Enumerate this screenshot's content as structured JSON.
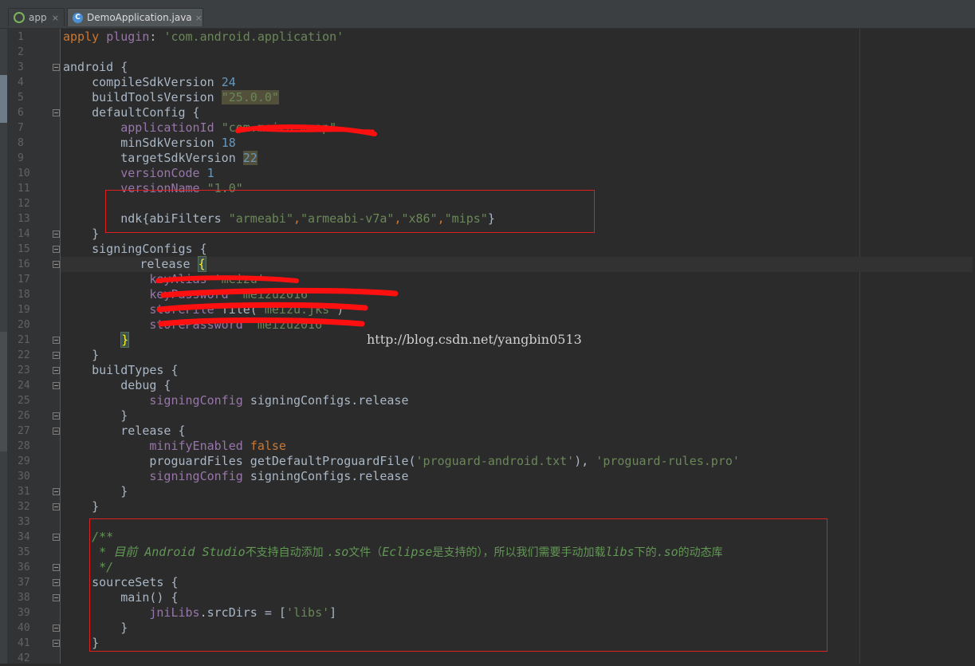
{
  "tabs": [
    {
      "label": "app",
      "close": "×",
      "icon": "gradle-icon"
    },
    {
      "label": "DemoApplication.java",
      "close": "×",
      "icon": "class-icon",
      "icon_letter": "C",
      "active": true
    }
  ],
  "watermark": "http://blog.csdn.net/yangbin0513",
  "gutter": {
    "line_numbers": [
      "1",
      "2",
      "3",
      "4",
      "5",
      "6",
      "7",
      "8",
      "9",
      "10",
      "11",
      "12",
      "13",
      "14",
      "15",
      "16",
      "17",
      "18",
      "19",
      "20",
      "21",
      "22",
      "23",
      "24",
      "25",
      "26",
      "27",
      "28",
      "29",
      "30",
      "31",
      "32",
      "33",
      "34",
      "35",
      "36",
      "37",
      "38",
      "39",
      "40",
      "41",
      "42"
    ]
  },
  "code": {
    "l1": {
      "kw": "apply ",
      "prop": "plugin",
      "rest": ": ",
      "str": "'com.android.application'"
    },
    "l3": {
      "text": "android {"
    },
    "l4": {
      "text": "    compileSdkVersion ",
      "num": "24"
    },
    "l5": {
      "text": "    buildToolsVersion ",
      "str": "\"25.0.0\""
    },
    "l6": {
      "text": "    defaultConfig {"
    },
    "l7": {
      "prop": "        applicationId ",
      "str": "\"com.meizu.mmap\""
    },
    "l8": {
      "text": "        minSdkVersion ",
      "num": "18"
    },
    "l9": {
      "text": "        targetSdkVersion ",
      "num": "22"
    },
    "l10": {
      "prop": "        versionCode ",
      "num": "1"
    },
    "l11": {
      "prop": "        versionName ",
      "str": "\"1.0\""
    },
    "l13": {
      "text": "        ndk{abiFilters ",
      "s1": "\"armeabi\"",
      "c1": ",",
      "s2": "\"armeabi-v7a\"",
      "c2": ",",
      "s3": "\"x86\"",
      "c3": ",",
      "s4": "\"mips\"",
      "end": "}"
    },
    "l14": {
      "text": "    }"
    },
    "l15": {
      "text": "    signingConfigs {"
    },
    "l16": {
      "text": "        release ",
      "brace": "{"
    },
    "l17": {
      "prop": "            keyAlias ",
      "str": "'meizu'"
    },
    "l18": {
      "prop": "            keyPassword ",
      "str": "'meizu2016'"
    },
    "l19": {
      "prop": "            storeFile ",
      "text": "file(",
      "str": "'meizu.jks'",
      "end": ")"
    },
    "l20": {
      "prop": "            storePassword ",
      "str": "'meizu2016'"
    },
    "l21": {
      "pre": "        ",
      "brace": "}"
    },
    "l22": {
      "text": "    }"
    },
    "l23": {
      "text": "    buildTypes {"
    },
    "l24": {
      "text": "        debug {"
    },
    "l25": {
      "prop": "            signingConfig ",
      "text": "signingConfigs.release"
    },
    "l26": {
      "text": "        }"
    },
    "l27": {
      "text": "        release {"
    },
    "l28": {
      "prop": "            minifyEnabled ",
      "kw": "false"
    },
    "l29": {
      "text": "            proguardFiles getDefaultProguardFile(",
      "s1": "'proguard-android.txt'",
      "mid": "), ",
      "s2": "'proguard-rules.pro'"
    },
    "l30": {
      "prop": "            signingConfig ",
      "text": "signingConfigs.release"
    },
    "l31": {
      "text": "        }"
    },
    "l32": {
      "text": "    }"
    },
    "l34": {
      "text": "    /**"
    },
    "l35": {
      "a": "     * 目前 ",
      "b": "Android Studio",
      "c": "不支持自动添加 ",
      "d": ".so",
      "e": "文件（",
      "f": "Eclipse",
      "g": "是支持的），所以我们需要手动加载",
      "h": "libs",
      "i": "下的",
      "j": ".so",
      "k": "的动态库"
    },
    "l36": {
      "text": "     */"
    },
    "l37": {
      "text": "    sourceSets {"
    },
    "l38": {
      "text": "        main() {"
    },
    "l39": {
      "prop": "            jniLibs",
      "text": ".srcDirs = [",
      "str": "'libs'",
      "end": "]"
    },
    "l40": {
      "text": "        }"
    },
    "l41": {
      "text": "    }"
    }
  }
}
